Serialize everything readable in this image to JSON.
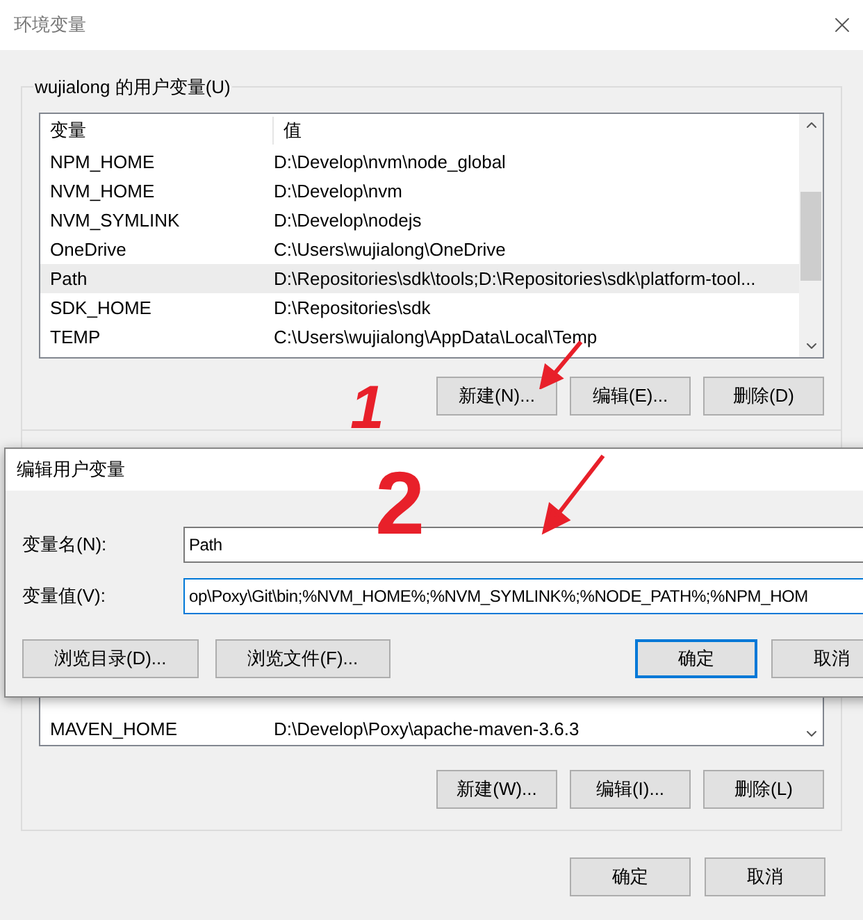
{
  "window": {
    "title": "环境变量"
  },
  "user_vars": {
    "label": "wujialong 的用户变量(U)",
    "columns": [
      "变量",
      "值"
    ],
    "rows": [
      {
        "name": "NPM_HOME",
        "value": "D:\\Develop\\nvm\\node_global",
        "selected": false
      },
      {
        "name": "NVM_HOME",
        "value": "D:\\Develop\\nvm",
        "selected": false
      },
      {
        "name": "NVM_SYMLINK",
        "value": "D:\\Develop\\nodejs",
        "selected": false
      },
      {
        "name": "OneDrive",
        "value": "C:\\Users\\wujialong\\OneDrive",
        "selected": false
      },
      {
        "name": "Path",
        "value": "D:\\Repositories\\sdk\\tools;D:\\Repositories\\sdk\\platform-tool...",
        "selected": true
      },
      {
        "name": "SDK_HOME",
        "value": "D:\\Repositories\\sdk",
        "selected": false
      },
      {
        "name": "TEMP",
        "value": "C:\\Users\\wujialong\\AppData\\Local\\Temp",
        "selected": false
      }
    ],
    "buttons": [
      "新建(N)...",
      "编辑(E)...",
      "删除(D)"
    ]
  },
  "system_vars": {
    "rows": [
      {
        "name": "MAVEN_HOME",
        "value": "D:\\Develop\\Poxy\\apache-maven-3.6.3",
        "selected": false
      }
    ],
    "buttons": [
      "新建(W)...",
      "编辑(I)...",
      "删除(L)"
    ]
  },
  "footer_buttons": [
    "确定",
    "取消"
  ],
  "edit_dialog": {
    "title": "编辑用户变量",
    "fields": [
      {
        "label": "变量名(N):",
        "value": "Path",
        "focused": false
      },
      {
        "label": "变量值(V):",
        "value": "op\\Poxy\\Git\\bin;%NVM_HOME%;%NVM_SYMLINK%;%NODE_PATH%;%NPM_HOM",
        "focused": true
      }
    ],
    "buttons": [
      {
        "label": "浏览目录(D)...",
        "default": false
      },
      {
        "label": "浏览文件(F)...",
        "default": false
      },
      {
        "label": "确定",
        "default": true
      },
      {
        "label": "取消",
        "default": false
      }
    ]
  },
  "annotations": [
    "1",
    "2"
  ]
}
